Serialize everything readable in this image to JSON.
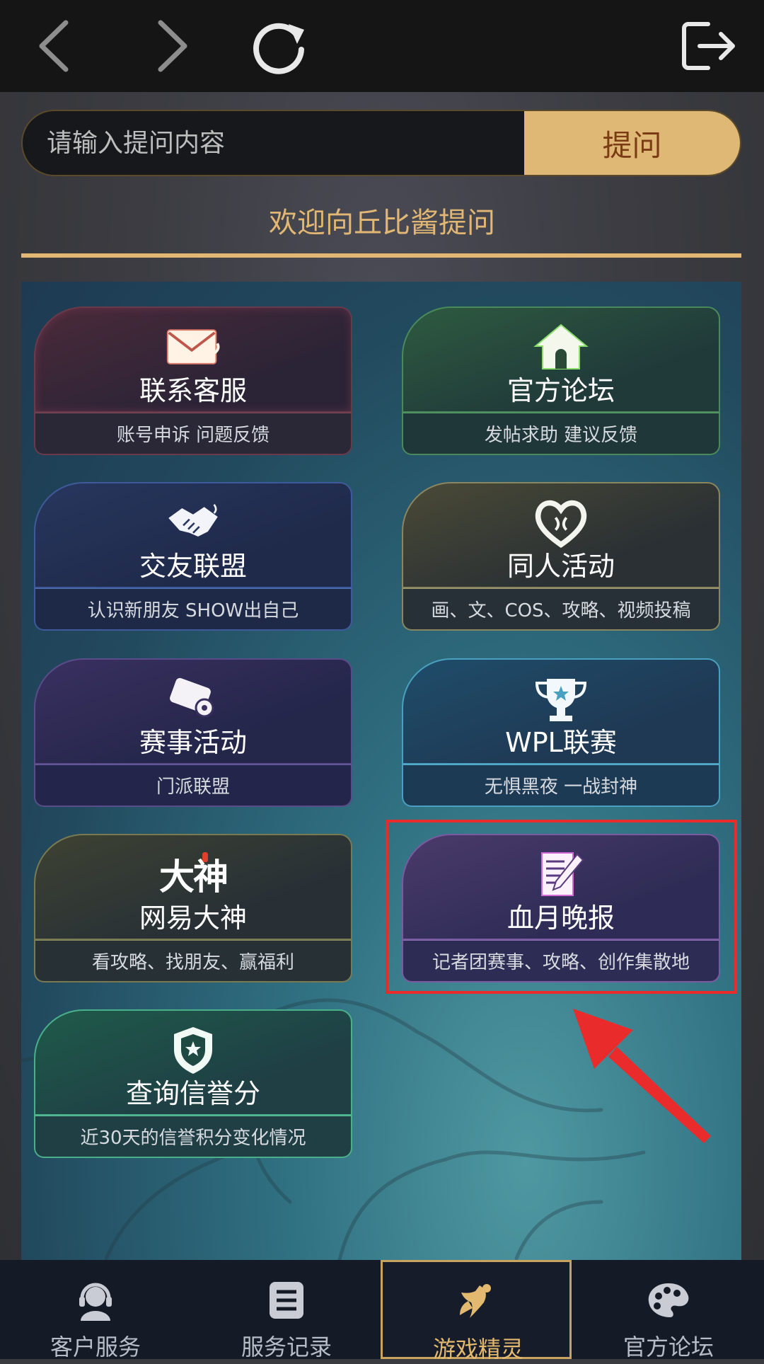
{
  "browser": {
    "back_icon": "chevron-left-icon",
    "forward_icon": "chevron-right-icon",
    "reload_icon": "reload-icon",
    "exit_icon": "logout-icon"
  },
  "search": {
    "placeholder": "请输入提问内容",
    "value": "",
    "button_label": "提问"
  },
  "welcome": {
    "text": "欢迎向丘比酱提问"
  },
  "cards": [
    {
      "title": "联系客服",
      "subtitle": "账号申诉   问题反馈",
      "icon": "envelope-icon"
    },
    {
      "title": "官方论坛",
      "subtitle": "发帖求助   建议反馈",
      "icon": "house-icon"
    },
    {
      "title": "交友联盟",
      "subtitle": "认识新朋友    SHOW出自己",
      "icon": "handshake-icon"
    },
    {
      "title": "同人活动",
      "subtitle": "画、文、COS、攻略、视频投稿",
      "icon": "heart-icon"
    },
    {
      "title": "赛事活动",
      "subtitle": "门派联盟",
      "icon": "scroll-icon"
    },
    {
      "title": "WPL联赛",
      "subtitle": "无惧黑夜 一战封神",
      "icon": "trophy-icon"
    },
    {
      "title": "网易大神",
      "subtitle": "看攻略、找朋友、赢福利",
      "icon": "dashen-logo",
      "logo_text": "大神"
    },
    {
      "title": "血月晚报",
      "subtitle": "记者团赛事、攻略、创作集散地",
      "icon": "newspaper-pencil-icon"
    },
    {
      "title": "查询信誉分",
      "subtitle": "近30天的信誉积分变化情况",
      "icon": "shield-star-icon"
    }
  ],
  "tabs": [
    {
      "label": "客户服务",
      "icon": "headset-icon",
      "active": false
    },
    {
      "label": "服务记录",
      "icon": "list-icon",
      "active": false
    },
    {
      "label": "游戏精灵",
      "icon": "fairy-icon",
      "active": true
    },
    {
      "label": "官方论坛",
      "icon": "palette-icon",
      "active": false
    }
  ],
  "colors": {
    "accent_gold": "#e0b876",
    "highlight_red": "#ea2b2b",
    "topbar": "#151515",
    "tabbar": "#141a26"
  }
}
